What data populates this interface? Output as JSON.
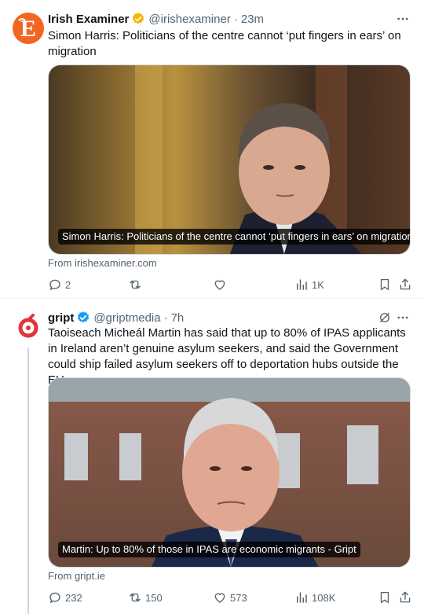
{
  "colors": {
    "text": "#0f1419",
    "secondary": "#536471",
    "verified": "#f4b400",
    "verified_blue": "#1d9bf0",
    "irish_examiner_brand": "#f26522",
    "gript_brand": "#e0353b"
  },
  "posts": [
    {
      "author": "Irish Examiner",
      "handle": "@irishexaminer",
      "time": "23m",
      "avatar_icon": "irish-examiner-logo",
      "verified_icon": "gold-verified-badge",
      "text": "Simon Harris: Politicians of the centre cannot ‘put fingers in ears’ on migration",
      "card_caption": "Simon Harris: Politicians of the centre cannot ‘put fingers in ears’ on migration",
      "card_source": "From irishexaminer.com",
      "replies": "2",
      "reposts": "",
      "likes": "",
      "views": "1K"
    },
    {
      "author": "gript",
      "handle": "@griptmedia",
      "time": "7h",
      "avatar_icon": "gript-logo",
      "verified_icon": "blue-verified-badge",
      "text": "Taoiseach Micheál Martin has said that up to 80% of IPAS applicants in Ireland aren’t genuine asylum seekers, and said the Government could ship failed asylum seekers off to deportation hubs outside the EU:",
      "card_caption": "Martin: Up to 80% of those in IPAS are economic migrants - Gript",
      "card_source": "From gript.ie",
      "replies": "232",
      "reposts": "150",
      "likes": "573",
      "views": "108K"
    }
  ]
}
